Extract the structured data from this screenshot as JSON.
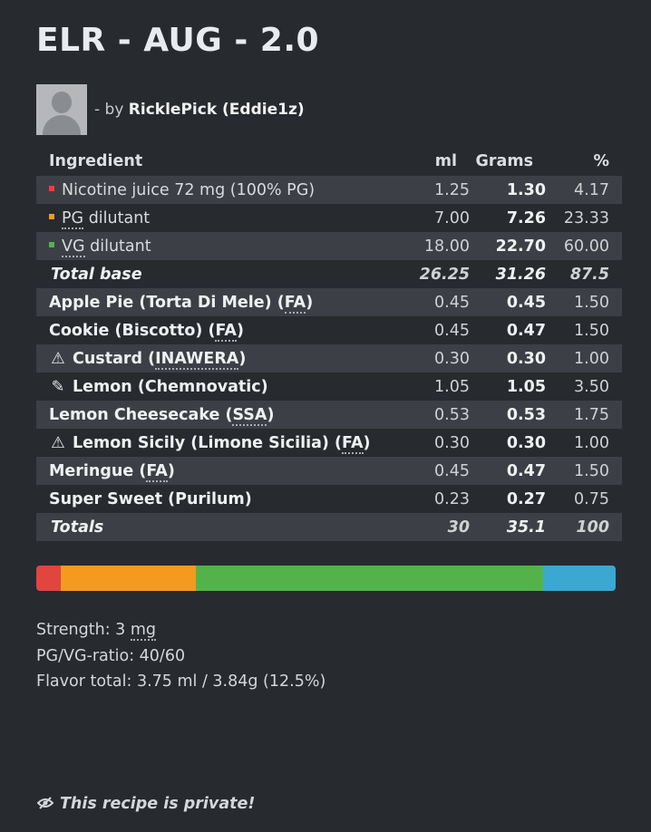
{
  "recipe": {
    "title": "ELR - AUG - 2.0",
    "by_prefix": "- by",
    "author": "RicklePick (Eddie1z)"
  },
  "table": {
    "headers": {
      "ingredient": "Ingredient",
      "ml": "ml",
      "grams": "Grams",
      "pct": "%"
    },
    "base_rows": [
      {
        "prefix": "",
        "name": "Nicotine juice 72 mg (100% PG)",
        "ml": "1.25",
        "grams": "1.30",
        "pct": "4.17",
        "color": "#e0453e"
      },
      {
        "prefix": "PG",
        "name": " dilutant",
        "ml": "7.00",
        "grams": "7.26",
        "pct": "23.33",
        "color": "#f39a1f"
      },
      {
        "prefix": "VG",
        "name": " dilutant",
        "ml": "18.00",
        "grams": "22.70",
        "pct": "60.00",
        "color": "#54b24a"
      }
    ],
    "total_base": {
      "label": "Total base",
      "ml": "26.25",
      "grams": "31.26",
      "pct": "87.5"
    },
    "flavor_rows": [
      {
        "icon": "",
        "name": "Apple Pie (Torta Di Mele) (",
        "abbr": "FA",
        "suffix": ")",
        "ml": "0.45",
        "grams": "0.45",
        "pct": "1.50"
      },
      {
        "icon": "",
        "name": "Cookie (Biscotto) (",
        "abbr": "FA",
        "suffix": ")",
        "ml": "0.45",
        "grams": "0.47",
        "pct": "1.50"
      },
      {
        "icon": "⚠",
        "name": "Custard (",
        "abbr": "INAWERA",
        "suffix": ")",
        "ml": "0.30",
        "grams": "0.30",
        "pct": "1.00"
      },
      {
        "icon": "✎",
        "name": "Lemon (Chemnovatic)",
        "abbr": "",
        "suffix": "",
        "ml": "1.05",
        "grams": "1.05",
        "pct": "3.50"
      },
      {
        "icon": "",
        "name": "Lemon Cheesecake (",
        "abbr": "SSA",
        "suffix": ")",
        "ml": "0.53",
        "grams": "0.53",
        "pct": "1.75"
      },
      {
        "icon": "⚠",
        "name": "Lemon Sicily (Limone Sicilia) (",
        "abbr": "FA",
        "suffix": ")",
        "ml": "0.30",
        "grams": "0.30",
        "pct": "1.00"
      },
      {
        "icon": "",
        "name": "Meringue (",
        "abbr": "FA",
        "suffix": ")",
        "ml": "0.45",
        "grams": "0.47",
        "pct": "1.50"
      },
      {
        "icon": "",
        "name": "Super Sweet (Purilum)",
        "abbr": "",
        "suffix": "",
        "ml": "0.23",
        "grams": "0.27",
        "pct": "0.75"
      }
    ],
    "totals": {
      "label": "Totals",
      "ml": "30",
      "grams": "35.1",
      "pct": "100"
    }
  },
  "ratio_bar": {
    "segments": [
      {
        "name": "nicotine",
        "percent": 4.17,
        "color": "#e0453e"
      },
      {
        "name": "pg",
        "percent": 23.33,
        "color": "#f39a1f"
      },
      {
        "name": "vg",
        "percent": 60.0,
        "color": "#54b24a"
      },
      {
        "name": "flavor",
        "percent": 12.5,
        "color": "#3ba8d2"
      }
    ]
  },
  "stats": {
    "strength_label": "Strength: 3 ",
    "strength_unit": "mg",
    "ratio": "PG/VG-ratio: 40/60",
    "flavor_total": "Flavor total: 3.75 ml / 3.84g (12.5%)"
  },
  "footer": {
    "icon": "eye-slash-icon",
    "private_text": "This recipe is private!"
  }
}
